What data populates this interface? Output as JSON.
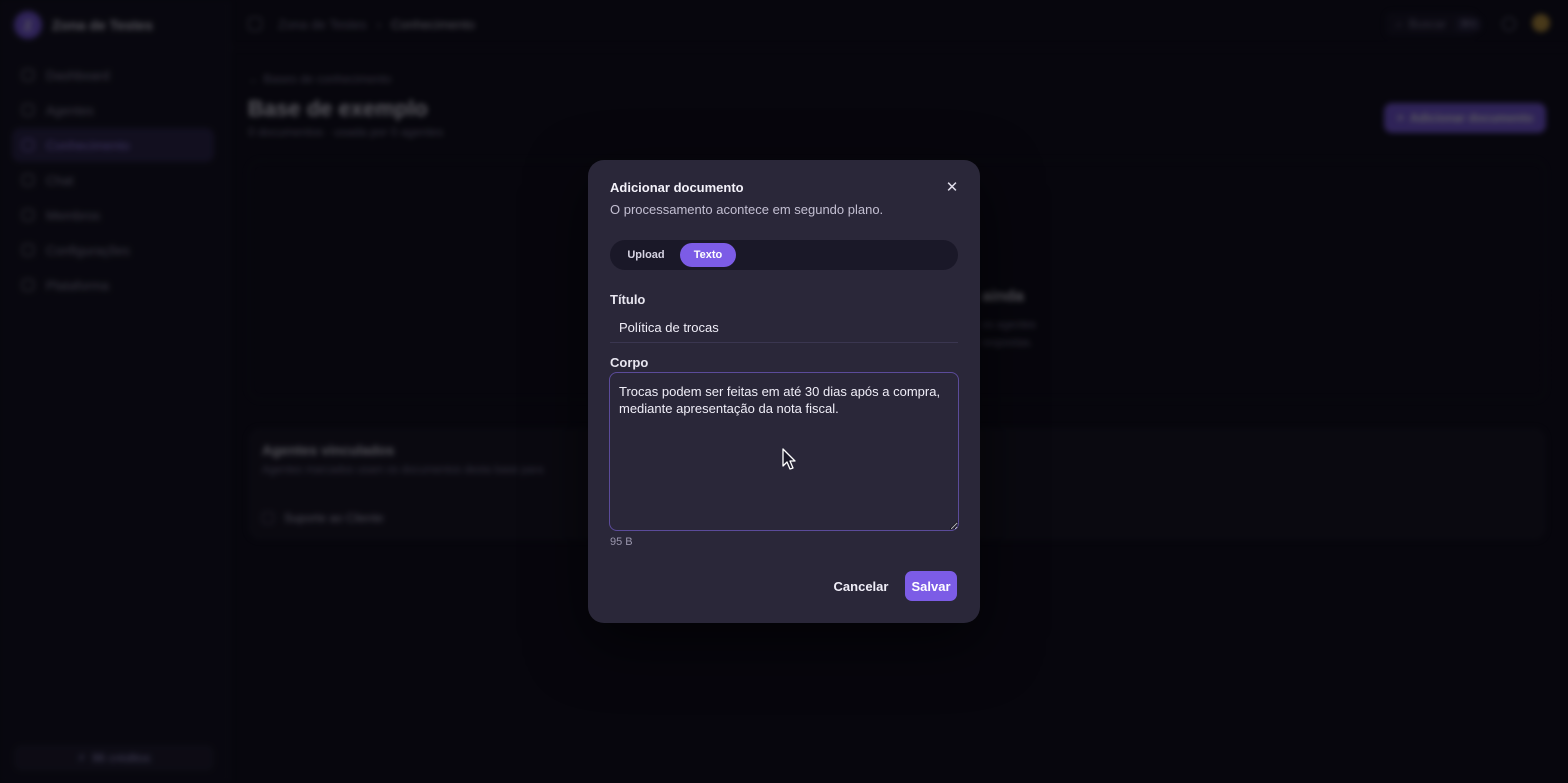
{
  "workspace": {
    "initial": "Z",
    "name": "Zona de Testes"
  },
  "sidebar": {
    "items": [
      {
        "label": "Dashboard",
        "icon": "dashboard-icon"
      },
      {
        "label": "Agentes",
        "icon": "bot-icon"
      },
      {
        "label": "Conhecimento",
        "icon": "book-icon",
        "active": true
      },
      {
        "label": "Chat",
        "icon": "chat-icon"
      },
      {
        "label": "Membros",
        "icon": "users-icon"
      },
      {
        "label": "Configurações",
        "icon": "gear-icon"
      },
      {
        "label": "Plataforma",
        "icon": "shield-icon"
      }
    ],
    "credits": "96 créditos"
  },
  "topbar": {
    "breadcrumb": [
      "Zona de Testes",
      "Conhecimento"
    ],
    "search_label": "Buscar",
    "search_shortcut": "⌘K"
  },
  "page": {
    "back_link": "Bases de conhecimento",
    "title": "Base de exemplo",
    "subtitle": "0 documentos · usada por 0 agentes",
    "add_button": "Adicionar documento",
    "empty_title": "ainda",
    "empty_desc_lines": [
      "os agentes",
      "respostas."
    ],
    "agents_title": "Agentes vinculados",
    "agents_desc": "Agentes marcados usam os documentos desta base para",
    "agent_name": "Suporte ao Cliente"
  },
  "modal": {
    "title": "Adicionar documento",
    "description": "O processamento acontece em segundo plano.",
    "tabs": {
      "upload": "Upload",
      "texto": "Texto",
      "active": "Texto"
    },
    "title_label": "Título",
    "title_value": "Política de trocas",
    "body_label": "Corpo",
    "body_value": "Trocas podem ser feitas em até 30 dias após a compra, mediante apresentação da nota fiscal.",
    "size_hint": "95 B",
    "cancel_label": "Cancelar",
    "save_label": "Salvar",
    "close_icon": "close-icon"
  },
  "colors": {
    "accent": "#7c5ce6",
    "background": "#0b0a14",
    "modal_bg": "#2a2739"
  }
}
